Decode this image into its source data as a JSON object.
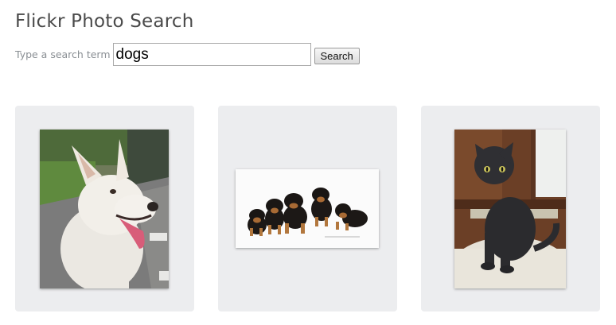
{
  "header": {
    "title": "Flickr Photo Search"
  },
  "search": {
    "label": "Type a search term",
    "value": "dogs",
    "button_label": "Search"
  },
  "results": [
    {
      "subject": "white shepherd dog"
    },
    {
      "subject": "row of puppies"
    },
    {
      "subject": "black kitten"
    }
  ]
}
